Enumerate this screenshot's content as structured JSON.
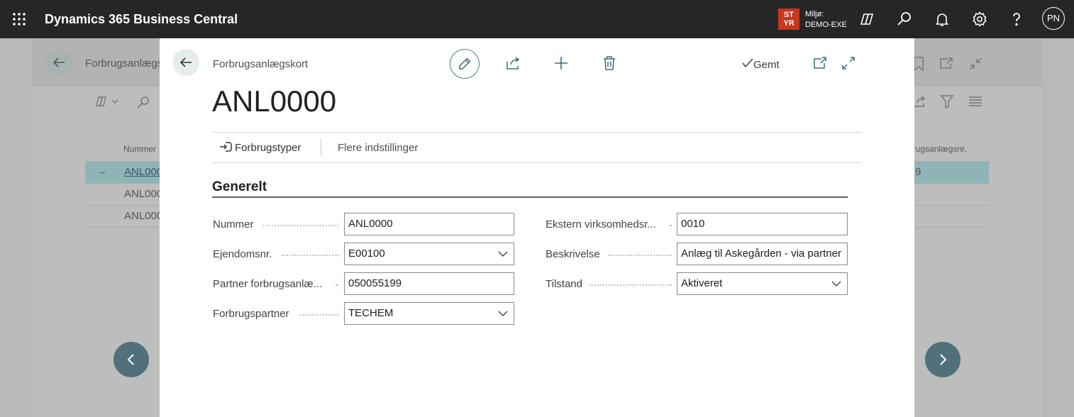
{
  "topbar": {
    "app_title": "Dynamics 365 Business Central",
    "env_badge": [
      "ST",
      "YR"
    ],
    "env_label": "Miljø:",
    "env_name": "DEMO-EXE",
    "avatar": "PN"
  },
  "background_page": {
    "title": "Forbrugsanlægs",
    "col_number": "Nummer",
    "col_partner": "rbrugsanlægsnr.",
    "rows": [
      {
        "number": "ANL000",
        "partner": "9",
        "selected": true
      },
      {
        "number": "ANL000",
        "partner": "",
        "selected": false
      },
      {
        "number": "ANL000",
        "partner": "",
        "selected": false
      }
    ]
  },
  "dialog": {
    "caption": "Forbrugsanlægskort",
    "title": "ANL0000",
    "saved_label": "Gemt",
    "actions": {
      "forbrugstyper": "Forbrugstyper",
      "more_settings": "Flere indstillinger"
    },
    "group_title": "Generelt",
    "fields": {
      "nummer": {
        "label": "Nummer",
        "value": "ANL0000"
      },
      "ejendomsnr": {
        "label": "Ejendomsnr.",
        "value": "E00100"
      },
      "partner_anlaeg": {
        "label": "Partner forbrugsanlæ...",
        "value": "050055199"
      },
      "forbrugspartner": {
        "label": "Forbrugspartner",
        "value": "TECHEM"
      },
      "ekstern": {
        "label": "Ekstern virksomhedsr...",
        "value": "0010"
      },
      "beskrivelse": {
        "label": "Beskrivelse",
        "value": "Anlæg til Askegården - via partner"
      },
      "tilstand": {
        "label": "Tilstand",
        "value": "Aktiveret"
      }
    }
  },
  "icons": {
    "accent": "#4a7f85",
    "topbar_bg": "#262626",
    "badge_bg": "#c8361b"
  }
}
